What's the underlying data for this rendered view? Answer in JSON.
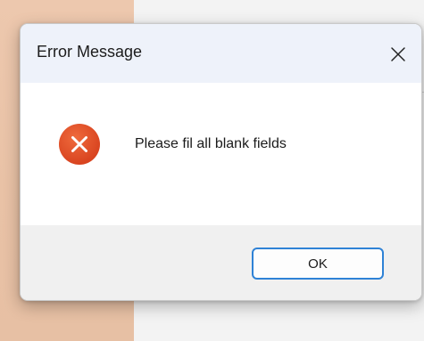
{
  "dialog": {
    "title": "Error Message",
    "close_icon": "close-icon",
    "icon": "error-icon",
    "message": "Please fil all blank fields",
    "ok_label": "OK"
  },
  "colors": {
    "error_icon": "#e2532c",
    "ok_border": "#2f82d6",
    "titlebar": "#eef2fa",
    "footer": "#f0f0f0",
    "background_left": "#edc8ae"
  }
}
